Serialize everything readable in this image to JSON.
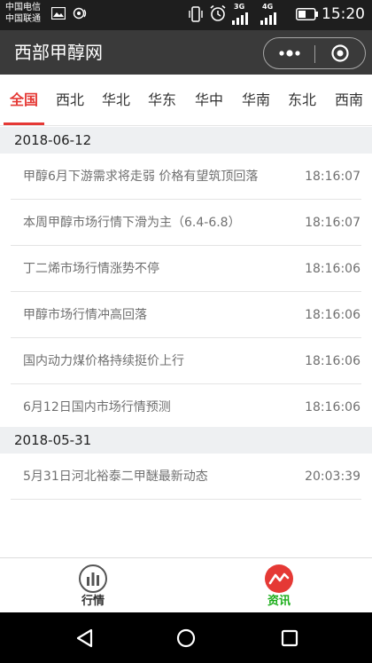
{
  "status_bar": {
    "carrier_1": "中国电信",
    "carrier_2": "中国联通",
    "net_3g": "3G",
    "net_4g": "4G",
    "time": "15:20"
  },
  "header": {
    "title": "西部甲醇网"
  },
  "tabs": [
    {
      "label": "全国",
      "active": true
    },
    {
      "label": "西北",
      "active": false
    },
    {
      "label": "华北",
      "active": false
    },
    {
      "label": "华东",
      "active": false
    },
    {
      "label": "华中",
      "active": false
    },
    {
      "label": "华南",
      "active": false
    },
    {
      "label": "东北",
      "active": false
    },
    {
      "label": "西南",
      "active": false
    }
  ],
  "news_groups": [
    {
      "date": "2018-06-12",
      "items": [
        {
          "title": "甲醇6月下游需求将走弱 价格有望筑顶回落",
          "time": "18:16:07"
        },
        {
          "title": "本周甲醇市场行情下滑为主（6.4-6.8）",
          "time": "18:16:07"
        },
        {
          "title": "丁二烯市场行情涨势不停",
          "time": "18:16:06"
        },
        {
          "title": "甲醇市场行情冲高回落",
          "time": "18:16:06"
        },
        {
          "title": "国内动力煤价格持续挺价上行",
          "time": "18:16:06"
        },
        {
          "title": "6月12日国内市场行情预测",
          "time": "18:16:06"
        }
      ]
    },
    {
      "date": "2018-05-31",
      "items": [
        {
          "title": "5月31日河北裕泰二甲醚最新动态",
          "time": "20:03:39"
        }
      ]
    }
  ],
  "bottom_tabs": [
    {
      "label": "行情",
      "icon": "market-chart-icon",
      "active": false
    },
    {
      "label": "资讯",
      "icon": "news-trend-icon",
      "active": true
    }
  ],
  "colors": {
    "accent": "#e53935",
    "active_green": "#1aad19",
    "header_bg": "#3a3a3a",
    "status_bg": "#1e1e1e"
  }
}
